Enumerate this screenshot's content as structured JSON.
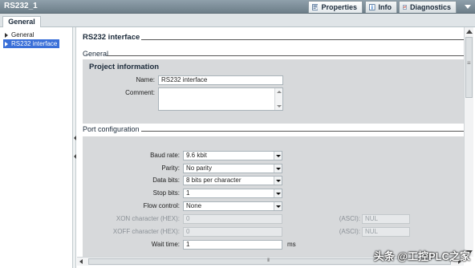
{
  "window": {
    "title": "RS232_1"
  },
  "inspector_tabs": [
    {
      "label": "Properties",
      "icon": "properties-icon"
    },
    {
      "label": "Info",
      "icon": "info-icon"
    },
    {
      "label": "Diagnostics",
      "icon": "diagnostics-icon"
    }
  ],
  "tabstrip": {
    "general_label": "General"
  },
  "nav": {
    "items": [
      {
        "label": "General",
        "selected": false
      },
      {
        "label": "RS232 interface",
        "selected": true
      }
    ]
  },
  "main": {
    "page_title": "RS232 interface",
    "general_heading": "General",
    "project_info": {
      "heading": "Project information",
      "name_label": "Name:",
      "name_value": "RS232 interface",
      "comment_label": "Comment:",
      "comment_value": ""
    },
    "port_config": {
      "heading": "Port configuration",
      "baud_rate": {
        "label": "Baud rate:",
        "value": "9.6 kbit"
      },
      "parity": {
        "label": "Parity:",
        "value": "No parity"
      },
      "data_bits": {
        "label": "Data bits:",
        "value": "8 bits per character"
      },
      "stop_bits": {
        "label": "Stop bits:",
        "value": "1"
      },
      "flow_control": {
        "label": "Flow control:",
        "value": "None"
      },
      "xon": {
        "label": "XON character (HEX):",
        "value": "0",
        "asci_label": "(ASCI):",
        "asci_value": "NUL"
      },
      "xoff": {
        "label": "XOFF character (HEX):",
        "value": "0",
        "asci_label": "(ASCI):",
        "asci_value": "NUL"
      },
      "wait_time": {
        "label": "Wait time:",
        "value": "1",
        "unit": "ms"
      }
    }
  },
  "watermark": {
    "text": "头条 @工控PLC之家"
  }
}
